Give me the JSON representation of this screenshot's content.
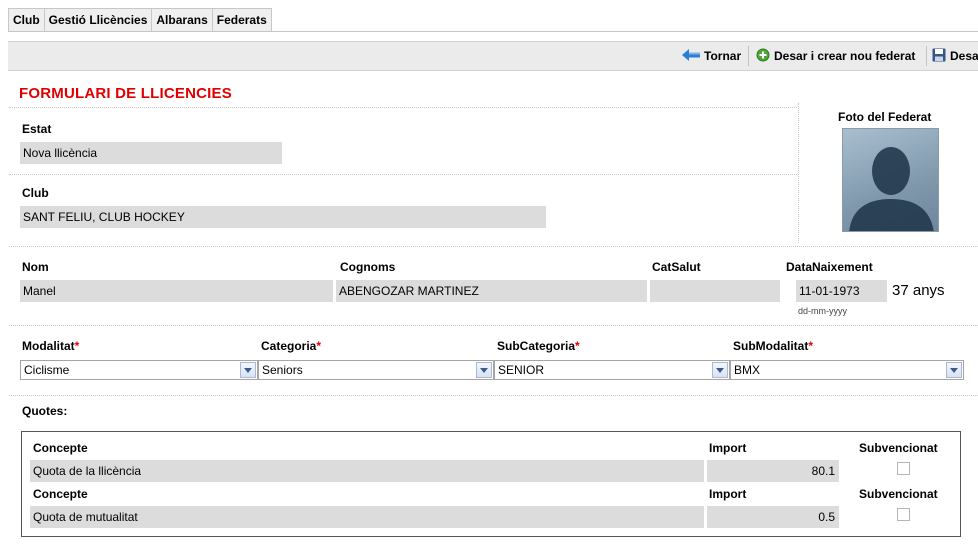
{
  "menu": {
    "items": [
      "Club",
      "Gestió Llicències",
      "Albarans",
      "Federats"
    ]
  },
  "toolbar": {
    "back_label": "Tornar",
    "save_new_label": "Desar i crear nou federat",
    "save_label": "Desa"
  },
  "form": {
    "title": "FORMULARI DE LLICENCIES",
    "photo_label": "Foto del Federat",
    "estat": {
      "label": "Estat",
      "value": "Nova llicència"
    },
    "club": {
      "label": "Club",
      "value": "SANT FELIU, CLUB HOCKEY"
    },
    "nom": {
      "label": "Nom",
      "value": "Manel"
    },
    "cognoms": {
      "label": "Cognoms",
      "value": "ABENGOZAR MARTINEZ"
    },
    "catsalut": {
      "label": "CatSalut",
      "value": ""
    },
    "data_naixement": {
      "label": "DataNaixement",
      "value": "11-01-1973",
      "age": "37 anys",
      "format_hint": "dd-mm-yyyy"
    },
    "modalitat": {
      "label": "Modalitat",
      "required": "*",
      "value": "Ciclisme"
    },
    "categoria": {
      "label": "Categoria",
      "required": "*",
      "value": "Seniors"
    },
    "subcategoria": {
      "label": "SubCategoria",
      "required": "*",
      "value": "SENIOR"
    },
    "submodalitat": {
      "label": "SubModalitat",
      "required": "*",
      "value": "BMX"
    }
  },
  "quotes": {
    "label": "Quotes:",
    "rows": [
      {
        "concepte_header": "Concepte",
        "import_header": "Import",
        "subv_header": "Subvencionat",
        "concepte": "Quota de la llicència",
        "import": "80.1",
        "subvencionat": false
      },
      {
        "concepte_header": "Concepte",
        "import_header": "Import",
        "subv_header": "Subvencionat",
        "concepte": "Quota de mutualitat",
        "import": "0.5",
        "subvencionat": false
      }
    ]
  },
  "colors": {
    "accent_red": "#e00000",
    "field_bg": "#dcdcdc",
    "toolbar_bg": "#ebebeb"
  }
}
